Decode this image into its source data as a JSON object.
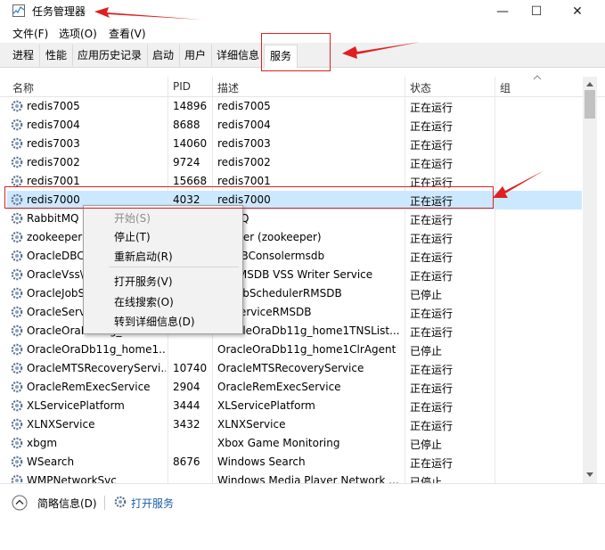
{
  "window": {
    "title": "任务管理器",
    "min": "—",
    "max": "☐",
    "close": "✕"
  },
  "menu": [
    "文件(F)",
    "选项(O)",
    "查看(V)"
  ],
  "tabs": [
    "进程",
    "性能",
    "应用历史记录",
    "启动",
    "用户",
    "详细信息",
    "服务"
  ],
  "columns": {
    "name": "名称",
    "pid": "PID",
    "desc": "描述",
    "status": "状态",
    "group": "组"
  },
  "rows": [
    {
      "name": "redis7005",
      "pid": "14896",
      "desc": "redis7005",
      "status": "正在运行"
    },
    {
      "name": "redis7004",
      "pid": "8688",
      "desc": "redis7004",
      "status": "正在运行"
    },
    {
      "name": "redis7003",
      "pid": "14060",
      "desc": "redis7003",
      "status": "正在运行"
    },
    {
      "name": "redis7002",
      "pid": "9724",
      "desc": "redis7002",
      "status": "正在运行"
    },
    {
      "name": "redis7001",
      "pid": "15668",
      "desc": "redis7001",
      "status": "正在运行"
    },
    {
      "name": "redis7000",
      "pid": "4032",
      "desc": "redis7000",
      "status": "正在运行"
    },
    {
      "name": "RabbitMQ",
      "pid": "",
      "desc": "bitMQ",
      "status": "正在运行"
    },
    {
      "name": "zookeeper",
      "pid": "",
      "desc": "keeper (zookeeper)",
      "status": "正在运行"
    },
    {
      "name": "OracleDBC",
      "pid": "",
      "desc": "cleDBConsolermsdb",
      "status": "正在运行"
    },
    {
      "name": "OracleVss\\",
      "pid": "",
      "desc": "le RMSDB VSS Writer Service",
      "status": "正在运行"
    },
    {
      "name": "OracleJobS",
      "pid": "",
      "desc": "cleJobSchedulerRMSDB",
      "status": "已停止"
    },
    {
      "name": "OracleServ",
      "pid": "",
      "desc": "cleServiceRMSDB",
      "status": "正在运行"
    },
    {
      "name": "OracleOraDb11g_home1",
      "pid": "4060",
      "desc": "OracleOraDb11g_home1TNSList...",
      "status": "正在运行"
    },
    {
      "name": "OracleOraDb11g_home1...",
      "pid": "",
      "desc": "OracleOraDb11g_home1ClrAgent",
      "status": "已停止"
    },
    {
      "name": "OracleMTSRecoveryServi...",
      "pid": "10740",
      "desc": "OracleMTSRecoveryService",
      "status": "正在运行"
    },
    {
      "name": "OracleRemExecService",
      "pid": "2904",
      "desc": "OracleRemExecService",
      "status": "正在运行"
    },
    {
      "name": "XLServicePlatform",
      "pid": "3444",
      "desc": "XLServicePlatform",
      "status": "正在运行"
    },
    {
      "name": "XLNXService",
      "pid": "3432",
      "desc": "XLNXService",
      "status": "正在运行"
    },
    {
      "name": "xbgm",
      "pid": "",
      "desc": "Xbox Game Monitoring",
      "status": "已停止"
    },
    {
      "name": "WSearch",
      "pid": "8676",
      "desc": "Windows Search",
      "status": "正在运行"
    },
    {
      "name": "WMPNetworkSvc",
      "pid": "",
      "desc": "Windows Media Player Network ...",
      "status": "已停止"
    }
  ],
  "selected_row": 5,
  "context_menu": {
    "start": "开始(S)",
    "stop": "停止(T)",
    "restart": "重新启动(R)",
    "open_services": "打开服务(V)",
    "search_online": "在线搜索(O)",
    "goto_details": "转到详细信息(D)"
  },
  "footer": {
    "brief": "简略信息(D)",
    "open_services": "打开服务"
  },
  "colors": {
    "selection": "#cce8ff",
    "annotation": "#e02020",
    "link": "#1a5ea8"
  }
}
